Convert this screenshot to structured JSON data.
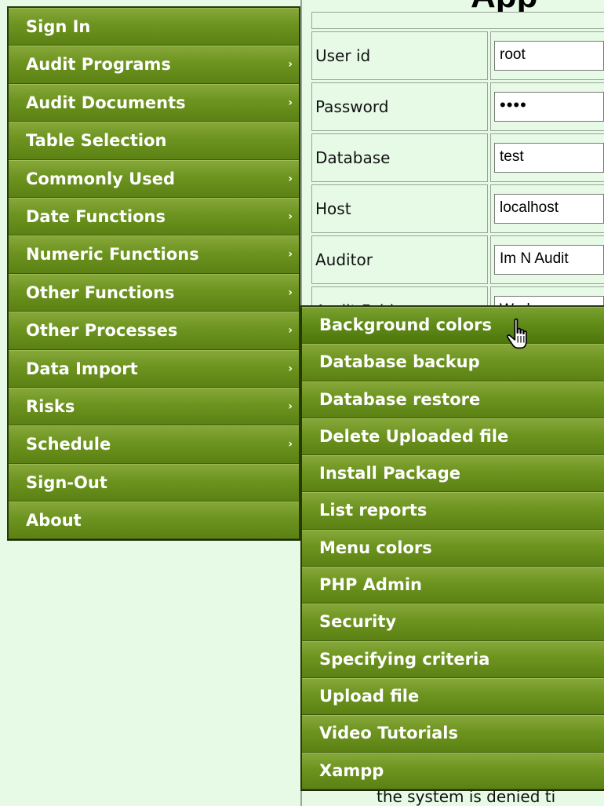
{
  "page": {
    "heading": "App"
  },
  "login_form": {
    "fields": [
      {
        "label": "User id",
        "value": "root"
      },
      {
        "label": "Password",
        "value": "••••"
      },
      {
        "label": "Database",
        "value": "test"
      },
      {
        "label": "Host",
        "value": "localhost"
      },
      {
        "label": "Auditor",
        "value": "Im N Audit"
      },
      {
        "label": "Audit Folder",
        "value": "Work"
      }
    ]
  },
  "background_text": "the system is denied ti",
  "main_menu": {
    "items": [
      {
        "label": "Sign In",
        "arrow": ""
      },
      {
        "label": "Audit Programs",
        "arrow": "›"
      },
      {
        "label": "Audit Documents",
        "arrow": "›"
      },
      {
        "label": "Table Selection",
        "arrow": ""
      },
      {
        "label": "Commonly Used",
        "arrow": "›"
      },
      {
        "label": "Date Functions",
        "arrow": "›"
      },
      {
        "label": "Numeric Functions",
        "arrow": "›"
      },
      {
        "label": "Other Functions",
        "arrow": "›"
      },
      {
        "label": "Other Processes",
        "arrow": "›"
      },
      {
        "label": "Data Import",
        "arrow": "›"
      },
      {
        "label": "Risks",
        "arrow": "›"
      },
      {
        "label": "Schedule",
        "arrow": "›"
      },
      {
        "label": "Sign-Out",
        "arrow": ""
      },
      {
        "label": "About",
        "arrow": ""
      }
    ]
  },
  "sub_menu": {
    "items": [
      {
        "label": "Background colors"
      },
      {
        "label": "Database backup"
      },
      {
        "label": "Database restore"
      },
      {
        "label": "Delete Uploaded file"
      },
      {
        "label": "Install Package"
      },
      {
        "label": "List reports"
      },
      {
        "label": "Menu colors"
      },
      {
        "label": "PHP Admin"
      },
      {
        "label": "Security"
      },
      {
        "label": "Specifying criteria"
      },
      {
        "label": "Upload file"
      },
      {
        "label": "Video Tutorials"
      },
      {
        "label": "Xampp"
      }
    ]
  },
  "colors": {
    "page_background": "#e6fae6",
    "menu_green": "#6d931f",
    "menu_text": "#ffffff"
  },
  "icons": {
    "cursor": "hand-pointer-icon"
  }
}
